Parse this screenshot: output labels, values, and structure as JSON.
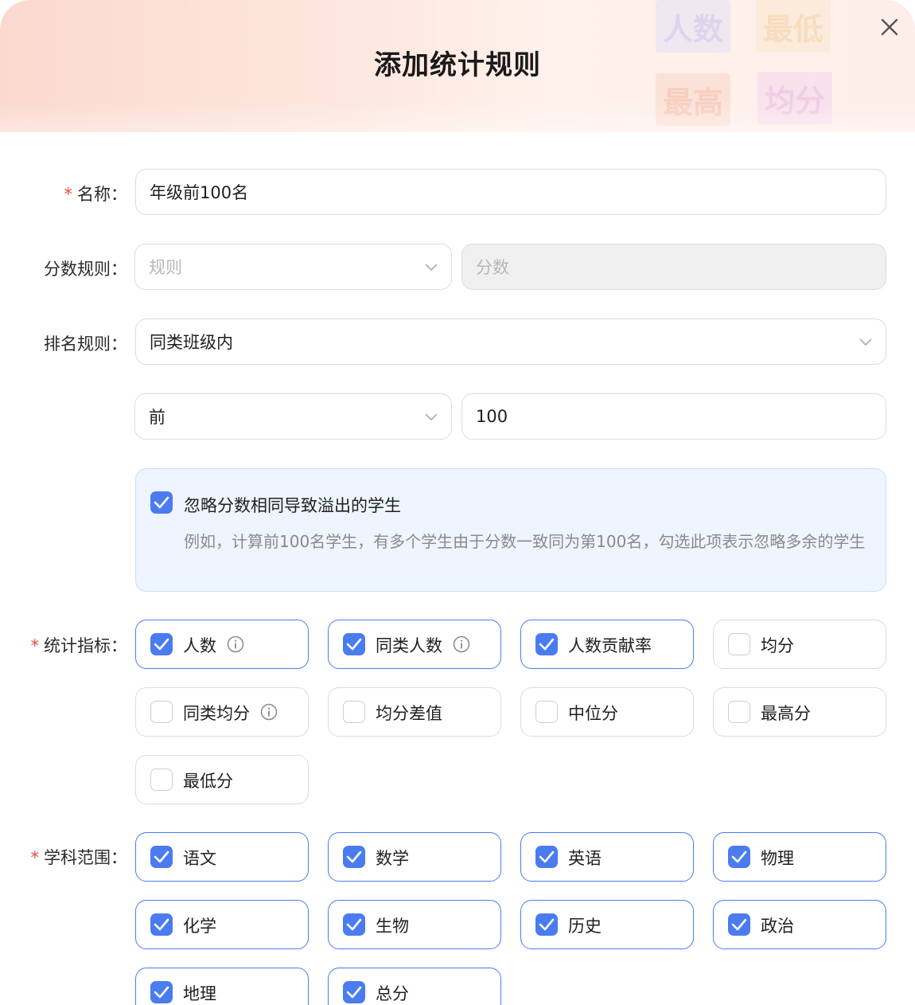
{
  "dialog": {
    "title": "添加统计规则",
    "decorations": [
      "人数",
      "最低",
      "最高",
      "均分"
    ]
  },
  "form": {
    "name": {
      "label": "名称：",
      "value": "年级前100名",
      "required": true
    },
    "score_rule": {
      "label": "分数规则：",
      "select_placeholder": "规则",
      "input_placeholder": "分数"
    },
    "rank_rule": {
      "label": "排名规则：",
      "value": "同类班级内"
    },
    "rank_range": {
      "direction": "前",
      "count": "100"
    },
    "ignore_overflow": {
      "checked": true,
      "label": "忽略分数相同导致溢出的学生",
      "description": "例如，计算前100名学生，有多个学生由于分数一致同为第100名，勾选此项表示忽略多余的学生"
    },
    "metrics": {
      "label": "统计指标：",
      "required": true,
      "items": [
        {
          "label": "人数",
          "checked": true,
          "info": true
        },
        {
          "label": "同类人数",
          "checked": true,
          "info": true
        },
        {
          "label": "人数贡献率",
          "checked": true,
          "info": false
        },
        {
          "label": "均分",
          "checked": false,
          "info": false
        },
        {
          "label": "同类均分",
          "checked": false,
          "info": true
        },
        {
          "label": "均分差值",
          "checked": false,
          "info": false
        },
        {
          "label": "中位分",
          "checked": false,
          "info": false
        },
        {
          "label": "最高分",
          "checked": false,
          "info": false
        },
        {
          "label": "最低分",
          "checked": false,
          "info": false
        }
      ]
    },
    "subjects": {
      "label": "学科范围：",
      "required": true,
      "items": [
        {
          "label": "语文",
          "checked": true
        },
        {
          "label": "数学",
          "checked": true
        },
        {
          "label": "英语",
          "checked": true
        },
        {
          "label": "物理",
          "checked": true
        },
        {
          "label": "化学",
          "checked": true
        },
        {
          "label": "生物",
          "checked": true
        },
        {
          "label": "历史",
          "checked": true
        },
        {
          "label": "政治",
          "checked": true
        },
        {
          "label": "地理",
          "checked": true
        },
        {
          "label": "总分",
          "checked": true
        }
      ]
    }
  },
  "colors": {
    "accent": "#4a7cf0",
    "required": "#f0463c",
    "border": "#dcdcdc",
    "notice_bg": "#eef5ff"
  }
}
